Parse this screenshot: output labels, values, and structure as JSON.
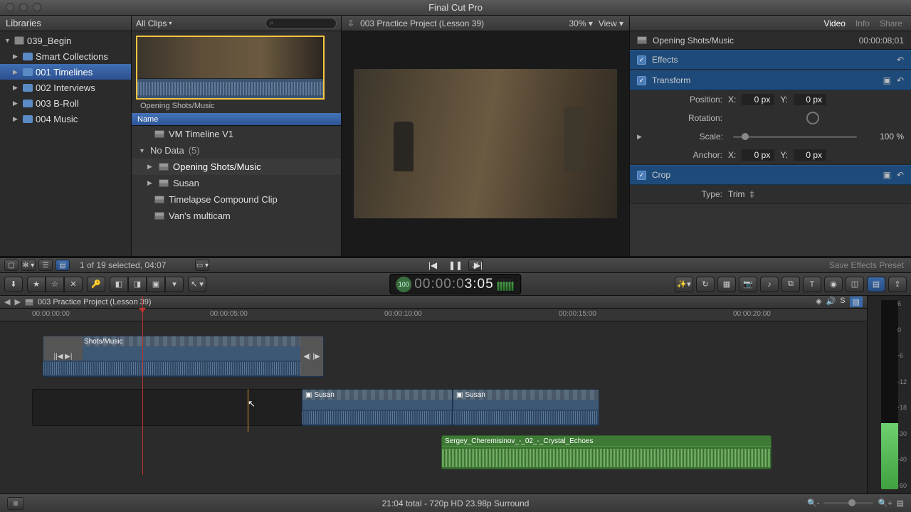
{
  "app_title": "Final Cut Pro",
  "libraries_header": "Libraries",
  "library": {
    "name": "039_Begin",
    "items": [
      {
        "label": "Smart Collections"
      },
      {
        "label": "001 Timelines",
        "selected": true
      },
      {
        "label": "002 Interviews"
      },
      {
        "label": "003 B-Roll"
      },
      {
        "label": "004 Music"
      }
    ]
  },
  "browser": {
    "filter": "All Clips",
    "filmstrip_label": "Opening Shots/Music",
    "table_header": "Name",
    "groups": [
      {
        "header": "No Data",
        "count": "(5)",
        "rows": [
          {
            "label": "VM Timeline V1"
          },
          {
            "label": "Opening Shots/Music",
            "selected": true,
            "has_disclosure": true
          },
          {
            "label": "Susan",
            "has_disclosure": true
          },
          {
            "label": "Timelapse Compound Clip"
          },
          {
            "label": "Van's multicam"
          }
        ]
      }
    ],
    "status": "1 of 19 selected, 04:07"
  },
  "viewer": {
    "title": "003 Practice Project (Lesson 39)",
    "zoom": "30%",
    "view_label": "View"
  },
  "inspector": {
    "tabs": {
      "video": "Video",
      "info": "Info",
      "share": "Share"
    },
    "clip_name": "Opening Shots/Music",
    "clip_tc": "00:00:08;01",
    "effects": "Effects",
    "transform": {
      "title": "Transform",
      "position_label": "Position:",
      "position_x": "0 px",
      "position_y": "0 px",
      "rotation_label": "Rotation:",
      "scale_label": "Scale:",
      "scale_val": "100 %",
      "anchor_label": "Anchor:",
      "anchor_x": "0 px",
      "anchor_y": "0 px"
    },
    "crop": {
      "title": "Crop",
      "type_label": "Type:",
      "type_val": "Trim"
    },
    "save_preset": "Save Effects Preset"
  },
  "timecode": {
    "value": "00:00:03:05",
    "badge": "100"
  },
  "timeline": {
    "project": "003 Practice Project (Lesson 39)",
    "ruler": [
      "00:00:00:00",
      "00:00:05:00",
      "00:00:10:00",
      "00:00:15:00",
      "00:00:20:00"
    ],
    "clips": {
      "opening": "Opening Shots/Music",
      "susan1": "Susan",
      "susan2": "Susan",
      "music": "Sergey_Cheremisinov_-_02_-_Crystal_Echoes"
    }
  },
  "meter_labels": [
    "6",
    "0",
    "-6",
    "-12",
    "-18",
    "-30",
    "-40",
    "-50"
  ],
  "bottom": {
    "summary": "21:04 total - 720p HD 23.98p Surround"
  },
  "xy": {
    "x": "X:",
    "y": "Y:"
  }
}
